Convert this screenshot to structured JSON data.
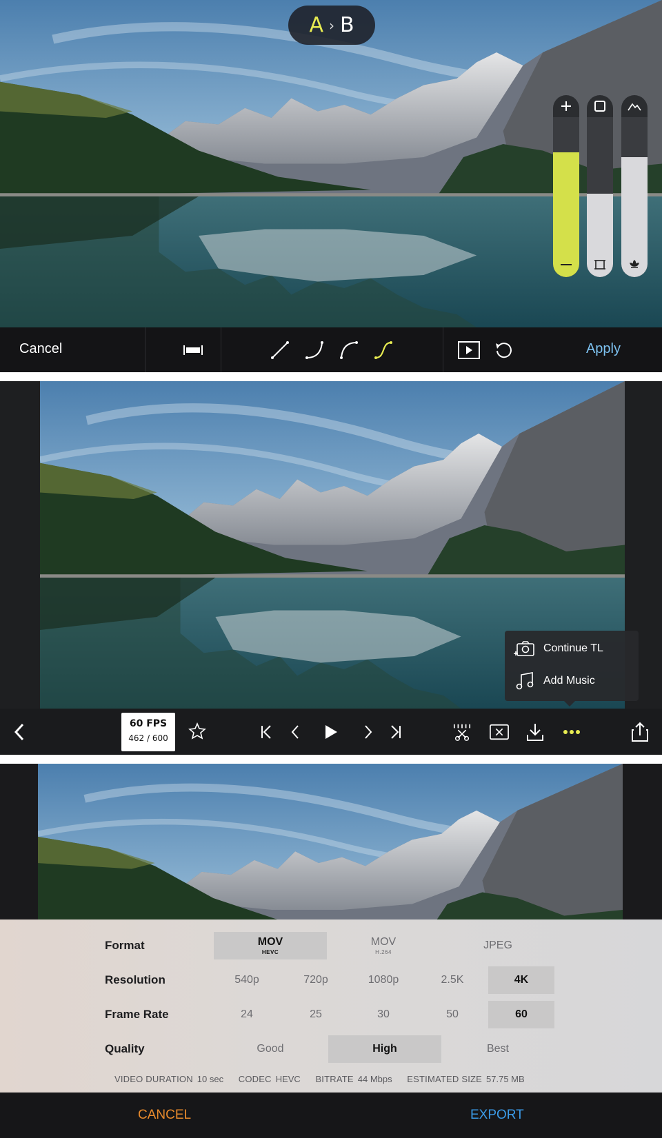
{
  "compare": {
    "a": "A",
    "separator": "›",
    "b": "B"
  },
  "sliders": [
    {
      "name": "brightness",
      "top_icon": "plus-icon",
      "bottom_icon": "minus-icon",
      "level": 0.78,
      "color": "#d4e04a"
    },
    {
      "name": "frame",
      "top_icon": "square-icon",
      "bottom_icon": "crop-icon",
      "level": 0.52,
      "color": "#d9d9dc"
    },
    {
      "name": "landscape",
      "top_icon": "mountain-icon",
      "bottom_icon": "flower-icon",
      "level": 0.75,
      "color": "#d9d9dc"
    }
  ],
  "curve_toolbar": {
    "cancel_label": "Cancel",
    "apply_label": "Apply",
    "icons": [
      "trim-icon",
      "linear-curve-icon",
      "ease-in-icon",
      "ease-out-icon",
      "ease-in-out-icon",
      "play-icon",
      "undo-icon"
    ],
    "selected_curve": "ease-in-out-icon",
    "accent_color": "#e8ec52"
  },
  "menu": {
    "items": [
      {
        "icon": "camera-add-icon",
        "label": "Continue TL"
      },
      {
        "icon": "music-note-icon",
        "label": "Add Music"
      }
    ]
  },
  "playback_toolbar": {
    "fps_label": "60 FPS",
    "frame_counter": "462 / 600",
    "icons": [
      "back-icon",
      "stabilize-icon",
      "skip-start-icon",
      "prev-frame-icon",
      "play-icon",
      "next-frame-icon",
      "skip-end-icon",
      "cut-icon",
      "delete-icon",
      "download-icon",
      "more-icon",
      "share-icon"
    ]
  },
  "export": {
    "rows": [
      {
        "label": "Format",
        "options": [
          {
            "text": "MOV",
            "sub": "HEVC",
            "selected": true
          },
          {
            "text": "MOV",
            "sub": "H.264",
            "selected": false
          },
          {
            "text": "JPEG",
            "sub": "",
            "selected": false
          }
        ]
      },
      {
        "label": "Resolution",
        "options": [
          {
            "text": "540p",
            "selected": false
          },
          {
            "text": "720p",
            "selected": false
          },
          {
            "text": "1080p",
            "selected": false
          },
          {
            "text": "2.5K",
            "selected": false
          },
          {
            "text": "4K",
            "selected": true
          }
        ]
      },
      {
        "label": "Frame Rate",
        "options": [
          {
            "text": "24",
            "selected": false
          },
          {
            "text": "25",
            "selected": false
          },
          {
            "text": "30",
            "selected": false
          },
          {
            "text": "50",
            "selected": false
          },
          {
            "text": "60",
            "selected": true
          }
        ]
      },
      {
        "label": "Quality",
        "options": [
          {
            "text": "Good",
            "selected": false
          },
          {
            "text": "High",
            "selected": true
          },
          {
            "text": "Best",
            "selected": false
          }
        ]
      }
    ],
    "info": {
      "duration_key": "VIDEO DURATION",
      "duration_val": "10 sec",
      "codec_key": "CODEC",
      "codec_val": "HEVC",
      "bitrate_key": "BITRATE",
      "bitrate_val": "44 Mbps",
      "size_key": "ESTIMATED SIZE",
      "size_val": "57.75 MB"
    },
    "cancel_label": "CANCEL",
    "export_label": "EXPORT"
  }
}
